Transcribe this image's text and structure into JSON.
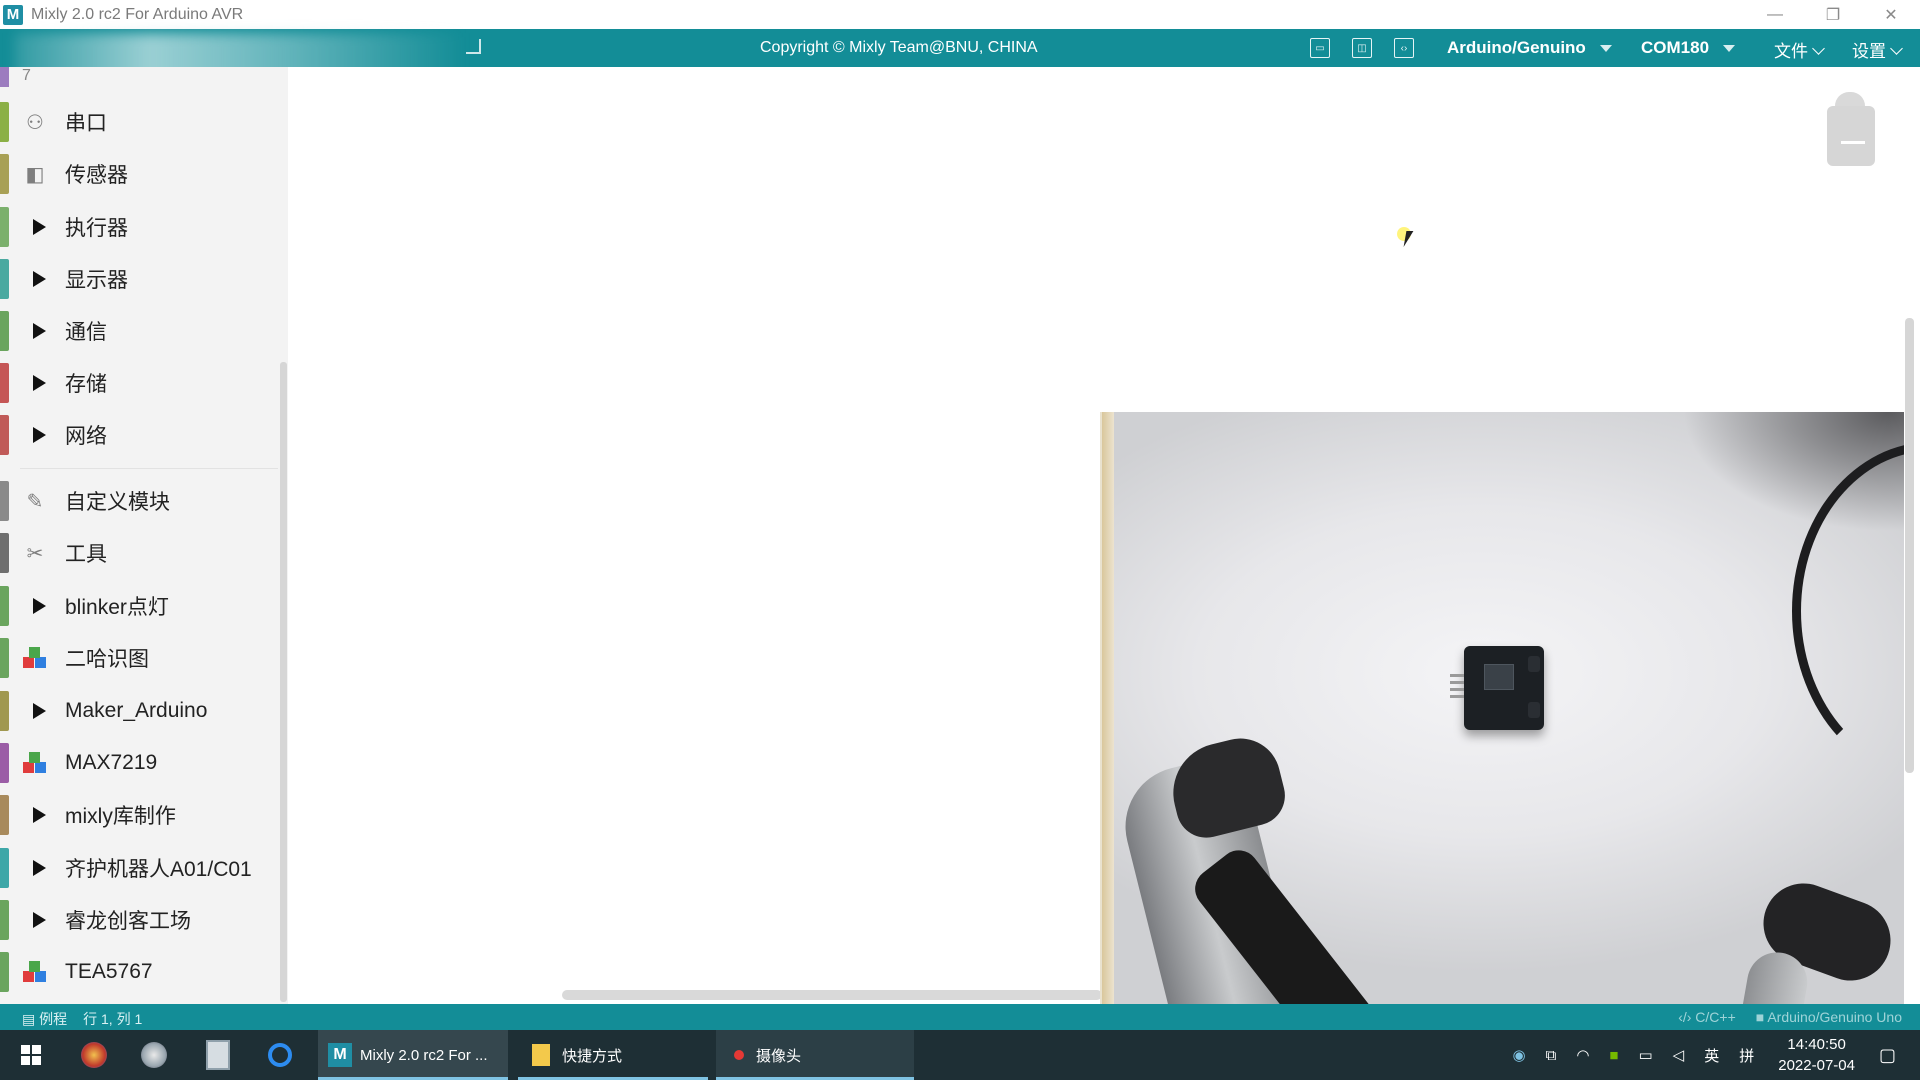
{
  "window": {
    "title": "Mixly 2.0 rc2 For Arduino AVR",
    "logo": "M",
    "controls": [
      "—",
      "❐",
      "✕"
    ]
  },
  "toolbar": {
    "copyright": "Copyright © Mixly Team@BNU, CHINA",
    "board": "Arduino/Genuino",
    "port": "COM180",
    "file_menu": "文件",
    "settings_menu": "设置",
    "icons": [
      "layout-icon",
      "split-view-icon",
      "code-view-icon"
    ],
    "accent": "#138d97"
  },
  "sidebar": {
    "partial_top": "7",
    "items": [
      {
        "label": "串口",
        "icon": "serial-icon",
        "color": "#8bb046",
        "expandable": false
      },
      {
        "label": "传感器",
        "icon": "sensor-icon",
        "color": "#a8a055",
        "expandable": false
      },
      {
        "label": "执行器",
        "icon": "arrow-right",
        "color": "#7bb06c",
        "expandable": true
      },
      {
        "label": "显示器",
        "icon": "arrow-right",
        "color": "#4aa9a0",
        "expandable": true
      },
      {
        "label": "通信",
        "icon": "arrow-right",
        "color": "#6aa55e",
        "expandable": true
      },
      {
        "label": "存储",
        "icon": "arrow-right",
        "color": "#c55656",
        "expandable": true
      },
      {
        "label": "网络",
        "icon": "arrow-right",
        "color": "#c05a58",
        "expandable": true
      },
      {
        "label": "自定义模块",
        "icon": "custom-module-icon",
        "color": "#8a8a8a",
        "expandable": false
      },
      {
        "label": "工具",
        "icon": "tools-icon",
        "color": "#6e6e6e",
        "expandable": false
      },
      {
        "label": "blinker点灯",
        "icon": "arrow-right",
        "color": "#6aa55e",
        "expandable": true
      },
      {
        "label": "二哈识图",
        "icon": "cubes-icon",
        "color": "#6aa55e",
        "expandable": false
      },
      {
        "label": "Maker_Arduino",
        "icon": "arrow-right",
        "color": "#a09850",
        "expandable": true
      },
      {
        "label": "MAX7219",
        "icon": "cubes-icon",
        "color": "#9b5da6",
        "expandable": false
      },
      {
        "label": "mixly库制作",
        "icon": "arrow-right",
        "color": "#a88a5c",
        "expandable": true
      },
      {
        "label": "齐护机器人A01/C01",
        "icon": "arrow-right",
        "color": "#3ea7a8",
        "expandable": true
      },
      {
        "label": "睿龙创客工场",
        "icon": "arrow-right",
        "color": "#6aa55e",
        "expandable": true
      },
      {
        "label": "TEA5767",
        "icon": "cubes-icon",
        "color": "#6aa55e",
        "expandable": false
      }
    ]
  },
  "statusbar": {
    "examples": "例程",
    "position": "行 1, 列 1",
    "language": "C/C++",
    "board": "Arduino/Genuino Uno"
  },
  "taskbar": {
    "apps": [
      {
        "label": "Mixly 2.0 rc2 For ...",
        "active": true
      },
      {
        "label": "快捷方式",
        "active": false
      },
      {
        "label": "摄像头",
        "active": false
      }
    ],
    "ime": "英",
    "keyboard": "拼",
    "time": "14:40:50",
    "date": "2022-07-04"
  }
}
